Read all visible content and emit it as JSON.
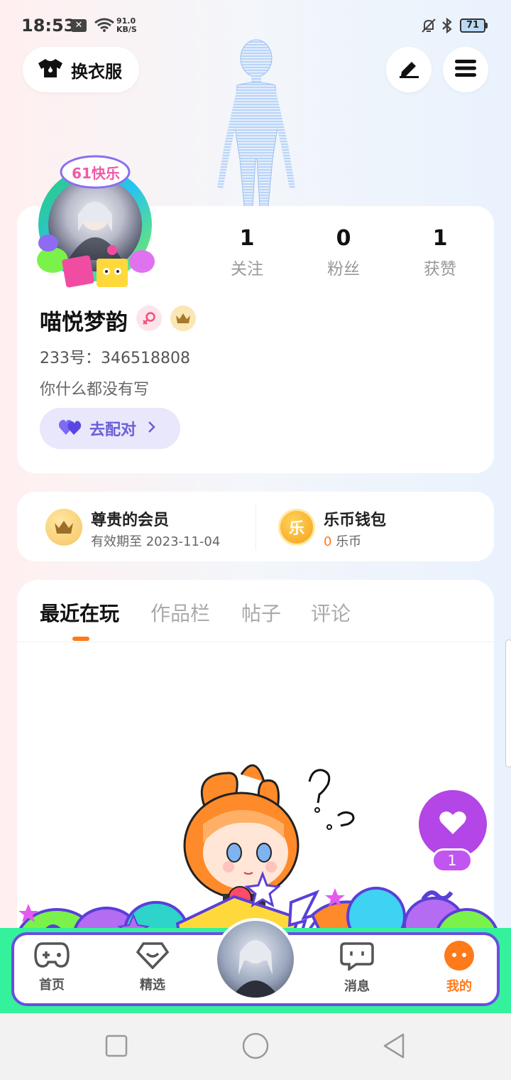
{
  "status_bar": {
    "time": "18:53",
    "net_speed_value": "91.0",
    "net_speed_unit": "KB/S",
    "battery": "71"
  },
  "header": {
    "outfit_label": "换衣服"
  },
  "profile": {
    "avatar_badge": "61快乐",
    "stats": [
      {
        "value": "1",
        "label": "关注"
      },
      {
        "value": "0",
        "label": "粉丝"
      },
      {
        "value": "1",
        "label": "获赞"
      }
    ],
    "username": "喵悦梦韵",
    "id_text": "233号：346518808",
    "bio": "你什么都没有写",
    "match_label": "去配对"
  },
  "membership": {
    "member_title": "尊贵的会员",
    "member_expiry": "有效期至 2023-11-04",
    "coin_icon_text": "乐",
    "wallet_title": "乐币钱包",
    "wallet_amount": "0",
    "wallet_unit": "乐币"
  },
  "tabs": [
    {
      "label": "最近在玩",
      "active": true
    },
    {
      "label": "作品栏",
      "active": false
    },
    {
      "label": "帖子",
      "active": false
    },
    {
      "label": "评论",
      "active": false
    }
  ],
  "like_count": "1",
  "bottom_nav": [
    {
      "label": "首页",
      "icon": "gamepad-icon"
    },
    {
      "label": "精选",
      "icon": "heart-diamond-icon"
    },
    {
      "label": "消息",
      "icon": "chat-icon"
    },
    {
      "label": "我的",
      "icon": "face-icon",
      "active": true
    }
  ],
  "colors": {
    "accent": "#ff7a1a",
    "purple": "#6a4de0",
    "like_purple": "#b445e6",
    "nav_green": "#33f29b"
  }
}
